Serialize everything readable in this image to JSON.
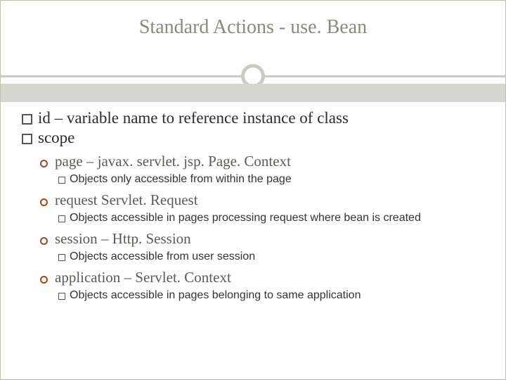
{
  "title": "Standard Actions - use. Bean",
  "bullets": {
    "id_line": "id – variable name to reference instance of class",
    "scope_line": "scope",
    "scopes": [
      {
        "head": "page – javax. servlet. jsp. Page. Context",
        "sub": "Objects only accessible from within the page"
      },
      {
        "head": "request Servlet. Request",
        "sub": "Objects accessible in pages processing request where bean is created"
      },
      {
        "head": "session – Http. Session",
        "sub": "Objects accessible from user session"
      },
      {
        "head": "application – Servlet. Context",
        "sub": "Objects accessible in pages belonging to same application"
      }
    ]
  }
}
